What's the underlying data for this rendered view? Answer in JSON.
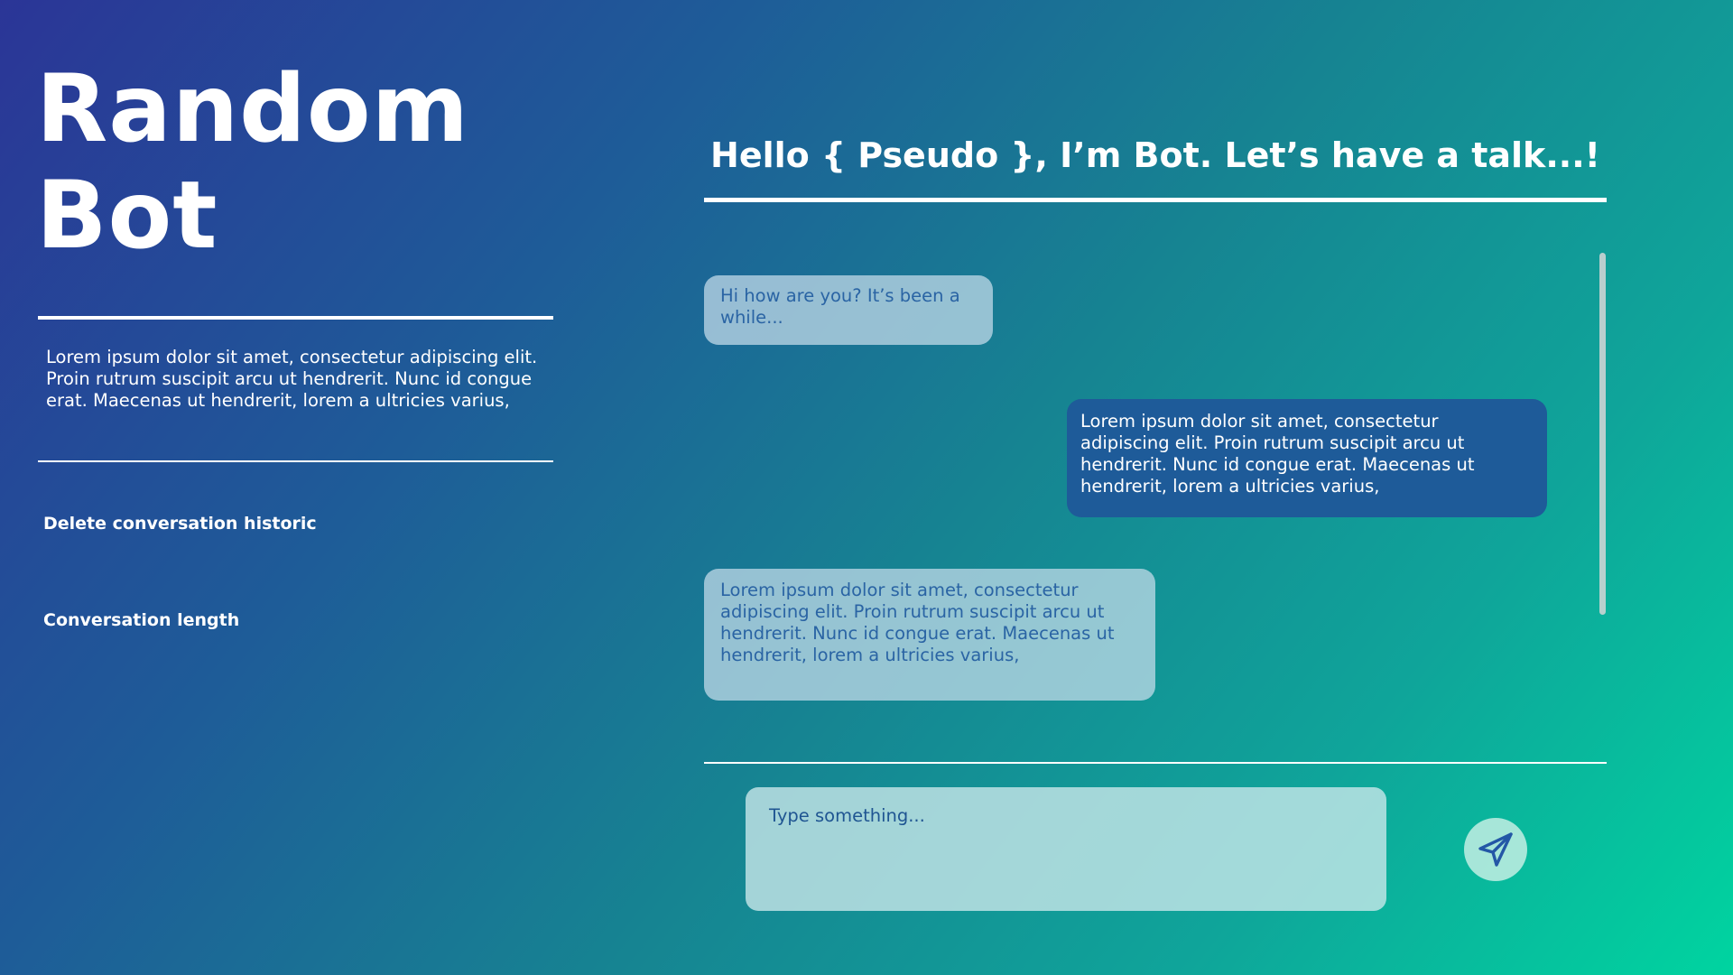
{
  "sidebar": {
    "title_line1": "Random",
    "title_line2": "Bot",
    "description": "Lorem ipsum dolor sit amet, consectetur adipiscing elit. Proin rutrum suscipit arcu ut hendrerit. Nunc id congue erat. Maecenas ut hendrerit, lorem a ultricies varius,",
    "delete_label": "Delete conversation historic",
    "length_label": "Conversation length"
  },
  "chat": {
    "greeting": "Hello { Pseudo }, I’m Bot. Let’s have a talk...!",
    "messages": [
      {
        "sender": "bot",
        "text": "Hi how are you? It’s been a while..."
      },
      {
        "sender": "user",
        "text": "Lorem ipsum dolor sit amet, consectetur adipiscing elit. Proin rutrum suscipit arcu ut hendrerit. Nunc id congue erat. Maecenas ut hendrerit, lorem a ultricies varius,"
      },
      {
        "sender": "bot",
        "text": "Lorem ipsum dolor sit amet, consectetur adipiscing elit. Proin rutrum suscipit arcu ut hendrerit. Nunc id congue erat. Maecenas ut hendrerit, lorem a ultricies varius,"
      }
    ],
    "input_placeholder": "Type something...",
    "send_icon": "paper-plane-icon"
  },
  "colors": {
    "gradient_start": "#2b3597",
    "gradient_end": "#00d4a0",
    "user_bubble": "#1e5b99",
    "bot_text": "#2a64a4"
  }
}
